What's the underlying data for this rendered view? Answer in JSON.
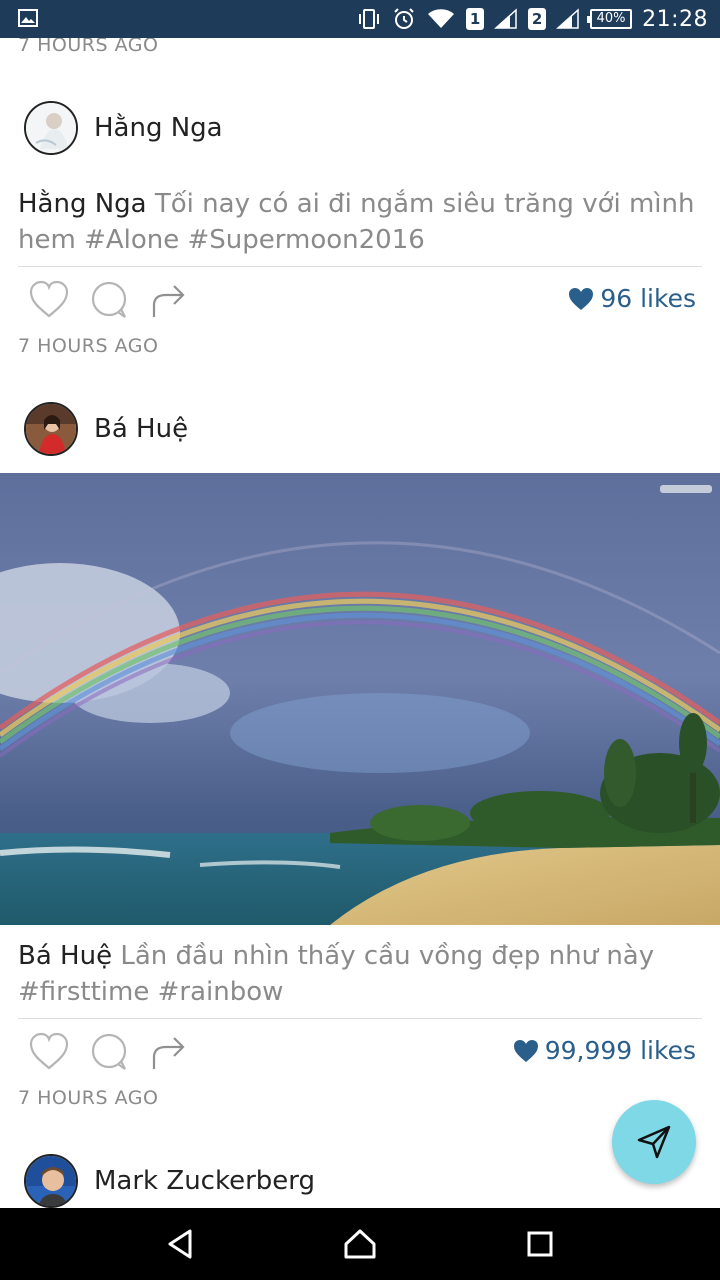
{
  "status_bar": {
    "sim1": "1",
    "sim2": "2",
    "battery": "40%",
    "time": "21:28",
    "icons": [
      "gallery-icon",
      "vibrate-icon",
      "alarm-icon",
      "wifi-icon",
      "signal-icon",
      "signal-icon",
      "battery-icon"
    ]
  },
  "feed": {
    "top_timestamp": "7 HOURS AGO",
    "posts": [
      {
        "username": "Hằng Nga",
        "caption_user": "Hằng Nga",
        "caption_text": " Tối nay có ai đi ngắm siêu trăng với mình hem #Alone #Supermoon2016",
        "likes": "96 likes",
        "timestamp": "7 HOURS AGO"
      },
      {
        "username": "Bá Huệ",
        "caption_user": "Bá Huệ",
        "caption_text": " Lần đầu nhìn thấy cầu vồng đẹp như này #firsttime #rainbow",
        "likes": "99,999 likes",
        "timestamp": "7 HOURS AGO"
      },
      {
        "username": "Mark Zuckerberg"
      }
    ]
  },
  "colors": {
    "status_bar": "#1e3b59",
    "likes_accent": "#2a5f8c",
    "fab": "#7fd8e6",
    "nav_bar": "#000000"
  }
}
